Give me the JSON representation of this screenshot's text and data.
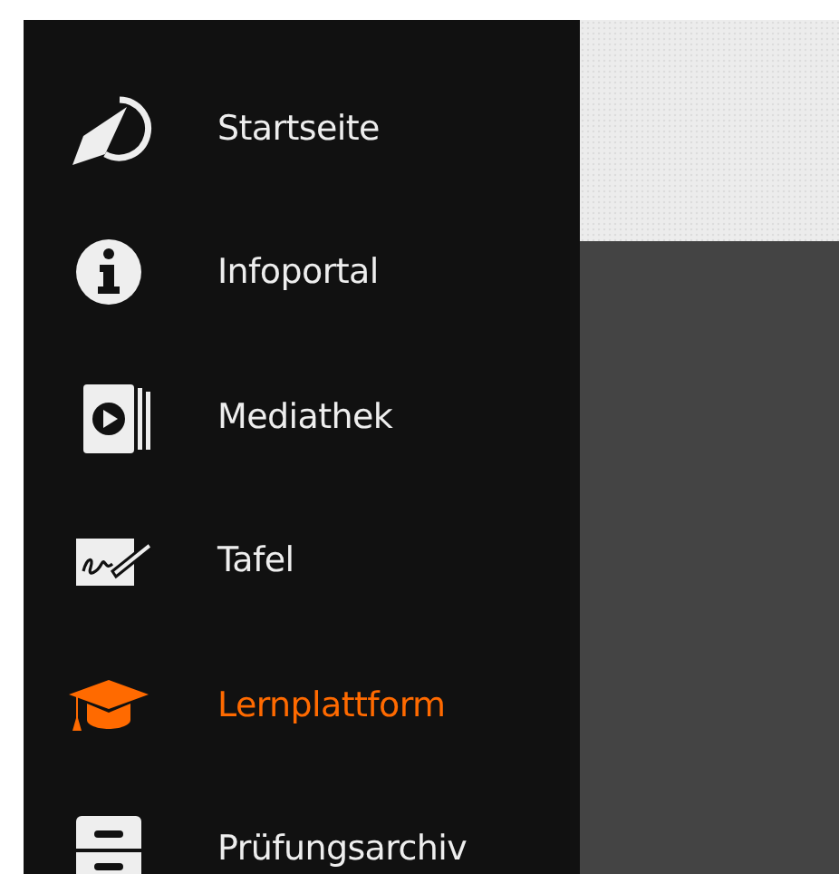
{
  "sidebar": {
    "items": [
      {
        "label": "Startseite",
        "selected": false
      },
      {
        "label": "Infoportal",
        "selected": false
      },
      {
        "label": "Mediathek",
        "selected": false
      },
      {
        "label": "Tafel",
        "selected": false
      },
      {
        "label": "Lernplattform",
        "selected": true
      },
      {
        "label": "Prüfungsarchiv",
        "selected": false
      }
    ]
  }
}
